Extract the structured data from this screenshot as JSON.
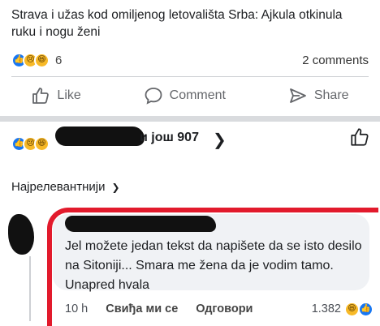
{
  "post": {
    "title": "Strava i užas kod omiljenog letovališta Srba: Ajkula otkinula ruku i nogu ženi",
    "reactions": {
      "icons": [
        "like-icon",
        "sad-icon",
        "haha-icon"
      ],
      "count": "6"
    },
    "comments_count": "2 comments"
  },
  "actions": {
    "like": "Like",
    "comment": "Comment",
    "share": "Share"
  },
  "comments_panel": {
    "likers_suffix": "и још 907",
    "sort_label": "Најрелевантнији"
  },
  "comment": {
    "text": "Jel možete jedan tekst da napišete da se isto desilo na Sitoniji... Smara me žena da je vodim tamo. Unapred hvala",
    "time": "10 h",
    "like_label": "Свиђа ми се",
    "reply_label": "Одговори",
    "reaction_count": "1.382"
  },
  "colors": {
    "like_blue": "#1877f2",
    "highlight_red": "#e21a2c"
  }
}
